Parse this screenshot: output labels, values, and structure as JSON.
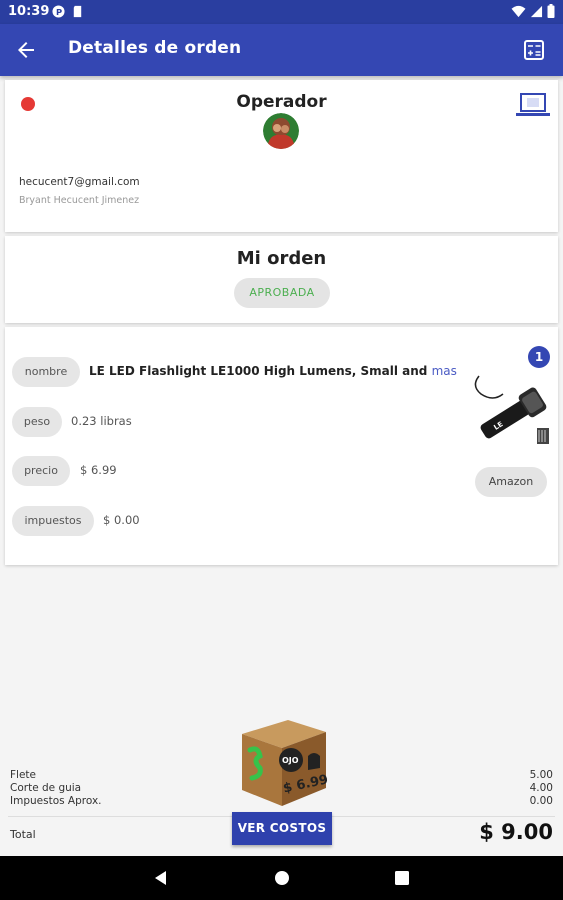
{
  "status_bar": {
    "time": "10:39"
  },
  "appbar": {
    "title": "Detalles de orden"
  },
  "operator": {
    "title": "Operador",
    "email": "hecucent7@gmail.com",
    "name": "Bryant Hecucent Jimenez",
    "status_color": "#e53935"
  },
  "order": {
    "title": "Mi orden",
    "status": "APROBADA"
  },
  "item": {
    "quantity": "1",
    "fields": {
      "name_label": "nombre",
      "name_value": "LE LED Flashlight LE1000 High Lumens, Small and",
      "more_link": "mas",
      "weight_label": "peso",
      "weight_value": "0.23 libras",
      "price_label": "precio",
      "price_value": "$ 6.99",
      "tax_label": "impuestos",
      "tax_value": "$ 0.00"
    },
    "store_button": "Amazon"
  },
  "box": {
    "brand": "OJO",
    "price": "$ 6.99"
  },
  "costs": {
    "rows": [
      {
        "label": "Flete",
        "value": "5.00"
      },
      {
        "label": "Corte de guia",
        "value": "4.00"
      },
      {
        "label": "Impuestos Aprox.",
        "value": "0.00"
      }
    ],
    "total_label": "Total",
    "total_value": "$ 9.00",
    "button_label": "VER COSTOS"
  },
  "colors": {
    "primary": "#3447b3",
    "approved": "#4caf50"
  }
}
